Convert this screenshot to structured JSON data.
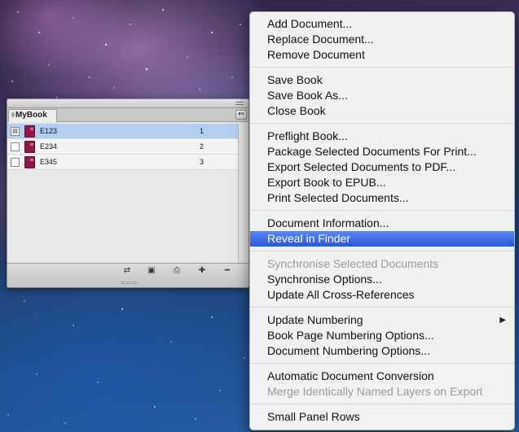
{
  "panel": {
    "tab_label": "MyBook",
    "tab_arrow": "◊",
    "menu_button": "▾≡",
    "documents": [
      {
        "name": "E123",
        "pages": "1",
        "selected": true
      },
      {
        "name": "E234",
        "pages": "2",
        "selected": false
      },
      {
        "name": "E345",
        "pages": "3",
        "selected": false
      }
    ],
    "bottom_buttons": {
      "sync": "⇄",
      "save": "▣",
      "print": "⎙",
      "add": "✚",
      "remove": "━"
    }
  },
  "menu": {
    "groups": [
      [
        "Add Document...",
        "Replace Document...",
        "Remove Document"
      ],
      [
        "Save Book",
        "Save Book As...",
        "Close Book"
      ],
      [
        "Preflight Book...",
        "Package Selected Documents For Print...",
        "Export Selected Documents to PDF...",
        "Export Book to EPUB...",
        "Print Selected Documents..."
      ],
      [
        "Document Information...",
        "Reveal in Finder"
      ],
      [
        "Synchronise Selected Documents",
        "Synchronise Options...",
        "Update All Cross-References"
      ],
      [
        "Update Numbering",
        "Book Page Numbering Options...",
        "Document Numbering Options..."
      ],
      [
        "Automatic Document Conversion",
        "Merge Identically Named Layers on Export"
      ],
      [
        "Small Panel Rows"
      ]
    ],
    "highlighted": "Reveal in Finder",
    "disabled": [
      "Synchronise Selected Documents",
      "Merge Identically Named Layers on Export"
    ],
    "submenu_arrow": "▶",
    "has_submenu": [
      "Update Numbering"
    ],
    "highlight_color": "#3a66e6"
  }
}
